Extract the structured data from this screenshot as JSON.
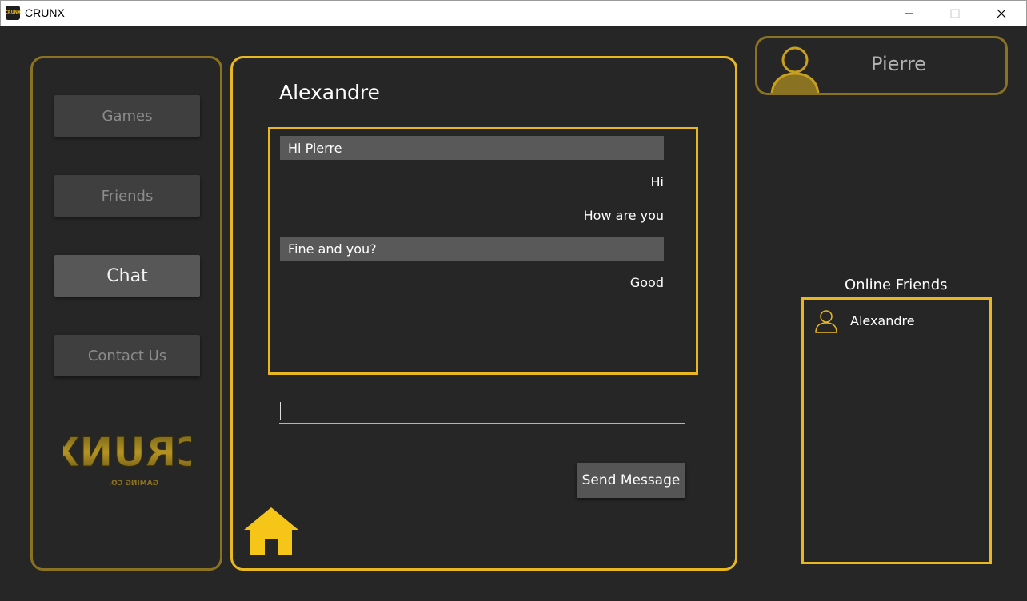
{
  "window": {
    "icon_text": "CRUNX",
    "title": "CRUNX"
  },
  "nav": {
    "items": [
      {
        "label": "Games",
        "active": false
      },
      {
        "label": "Friends",
        "active": false
      },
      {
        "label": "Chat",
        "active": true
      },
      {
        "label": "Contact Us",
        "active": false
      }
    ],
    "logo_text": "CRUNX",
    "logo_subtext": "GAMING CO."
  },
  "chat": {
    "contact_name": "Alexandre",
    "messages": [
      {
        "text": "Hi Pierre",
        "direction": "received"
      },
      {
        "text": "Hi",
        "direction": "sent"
      },
      {
        "text": "How are you",
        "direction": "sent"
      },
      {
        "text": "Fine and you?",
        "direction": "received"
      },
      {
        "text": "Good",
        "direction": "sent"
      }
    ],
    "input_value": "",
    "send_label": "Send Message"
  },
  "profile": {
    "name": "Pierre"
  },
  "online_friends": {
    "title": "Online Friends",
    "friends": [
      "Alexandre"
    ]
  },
  "colors": {
    "accent": "#e9b820",
    "accent_dim": "#8a7223",
    "background": "#262626"
  }
}
